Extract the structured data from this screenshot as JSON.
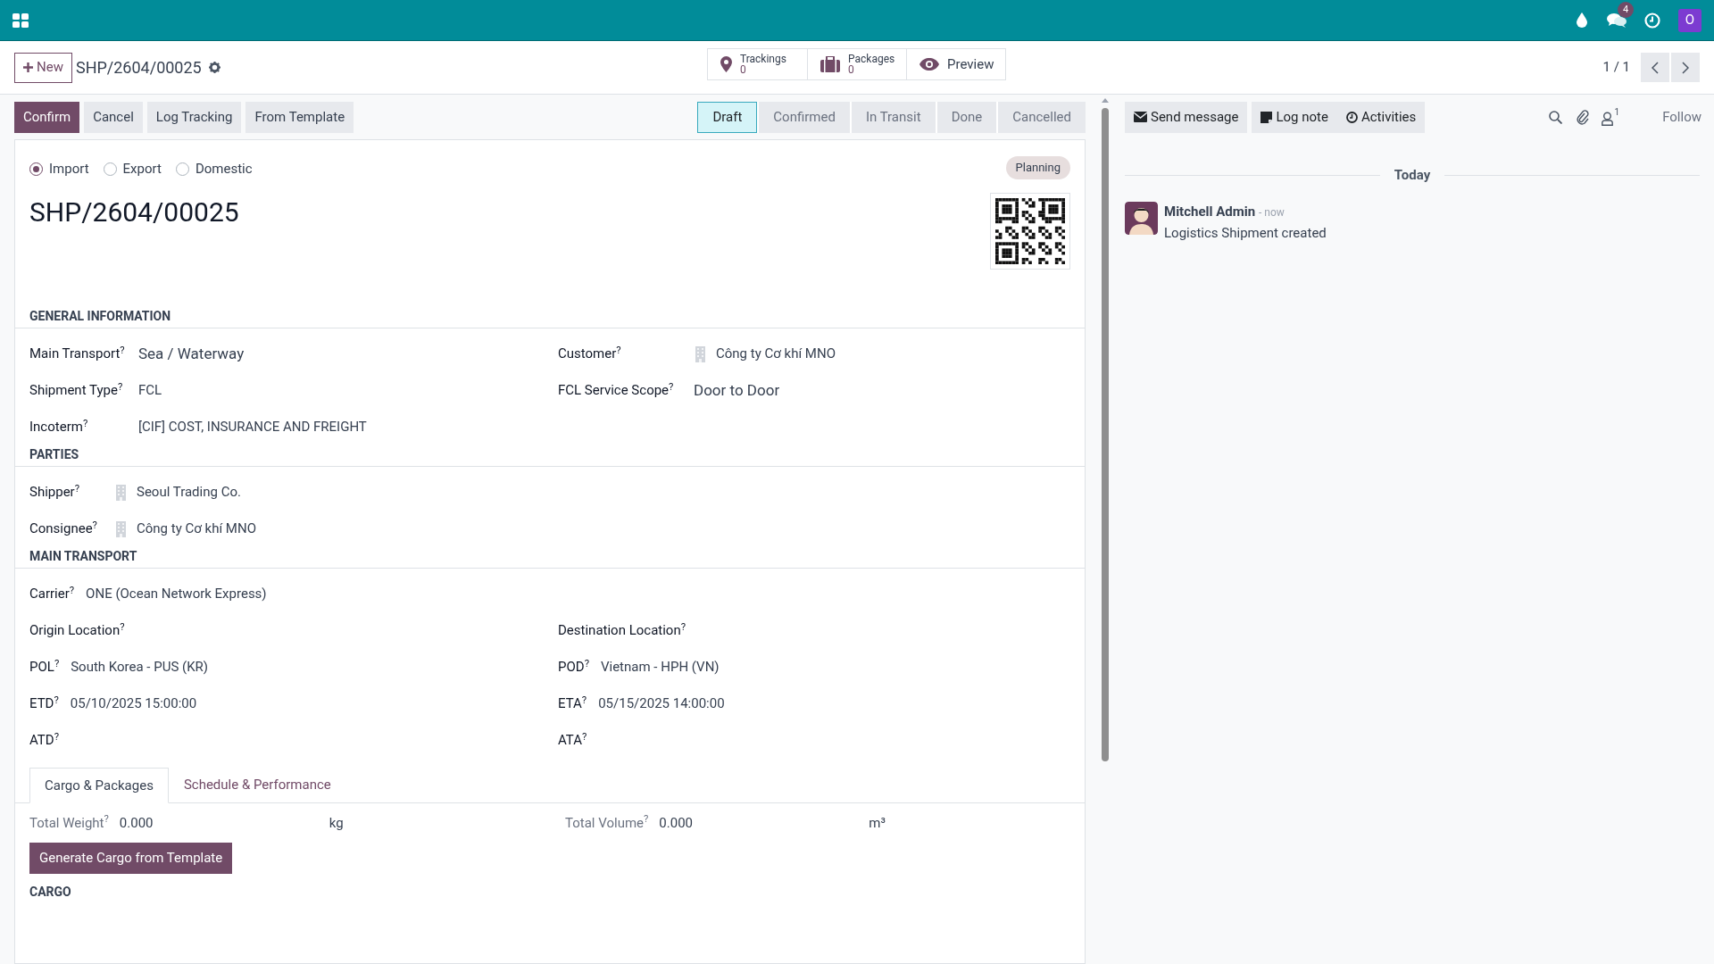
{
  "navbar": {
    "message_count": "4",
    "avatar_letter": "O"
  },
  "control_panel": {
    "new_button": "New",
    "breadcrumb": "SHP/2604/00025",
    "smart_buttons": [
      {
        "kind": "stat",
        "label": "Trackings",
        "value": "0"
      },
      {
        "kind": "stat",
        "label": "Packages",
        "value": "0"
      },
      {
        "kind": "action",
        "label": "Preview"
      }
    ],
    "pager": "1 / 1"
  },
  "action_buttons": [
    {
      "label": "Confirm",
      "kind": "primary"
    },
    {
      "label": "Cancel",
      "kind": "secondary"
    },
    {
      "label": "Log Tracking",
      "kind": "secondary"
    },
    {
      "label": "From Template",
      "kind": "secondary"
    }
  ],
  "status_steps": [
    {
      "label": "Draft",
      "selected": true
    },
    {
      "label": "Confirmed",
      "selected": false
    },
    {
      "label": "In Transit",
      "selected": false
    },
    {
      "label": "Done",
      "selected": false
    },
    {
      "label": "Cancelled",
      "selected": false
    }
  ],
  "form": {
    "direction_options": [
      {
        "label": "Import",
        "selected": true
      },
      {
        "label": "Export",
        "selected": false
      },
      {
        "label": "Domestic",
        "selected": false
      }
    ],
    "tag": "Planning",
    "title": "SHP/2604/00025",
    "sections": [
      {
        "title": "GENERAL INFORMATION",
        "rows": [
          [
            {
              "label": "Main Transport$^{?}$",
              "kind": "selection",
              "value": "Sea / Waterway"
            },
            {
              "label": "Customer$^{?}$",
              "kind": "partner",
              "value": "Công ty Cơ khí MNO"
            }
          ],
          [
            {
              "label": "Shipment Type$^{?}$",
              "kind": "text",
              "value": "FCL"
            },
            {
              "label": "FCL Service Scope$^{?}$",
              "kind": "selection",
              "value": "Door to Door"
            }
          ],
          [
            {
              "label": "Incoterm$^{?}$",
              "kind": "text",
              "value": "[CIF] COST, INSURANCE AND FREIGHT"
            }
          ]
        ]
      },
      {
        "title": "PARTIES",
        "rows": [
          [
            {
              "label": "Shipper$^{?}$",
              "kind": "partner",
              "value": "Seoul Trading Co."
            }
          ],
          [
            {
              "label": "Consignee$^{?}$",
              "kind": "partner",
              "value": "Công ty Cơ khí MNO"
            }
          ]
        ]
      },
      {
        "title": "MAIN TRANSPORT",
        "rows": [
          [
            {
              "label": "Carrier$^{?}$",
              "kind": "text",
              "value": "ONE (Ocean Network Express)"
            }
          ],
          [
            {
              "label": "Origin Location$^{?}$",
              "kind": "empty"
            },
            {
              "label": "Destination Location$^{?}$",
              "kind": "empty"
            }
          ],
          [
            {
              "label": "POL$^{?}$",
              "kind": "text",
              "value": "South Korea - PUS (KR)"
            },
            {
              "label": "POD$^{?}$",
              "kind": "text",
              "value": "Vietnam - HPH (VN)"
            }
          ],
          [
            {
              "label": "ETD$^{?}$",
              "kind": "text",
              "value": "05/10/2025 15:00:00"
            },
            {
              "label": "ETA$^{?}$",
              "kind": "text",
              "value": "05/15/2025 14:00:00"
            }
          ],
          [
            {
              "label": "ATD$^{?}$",
              "kind": "empty"
            },
            {
              "label": "ATA$^{?}$",
              "kind": "empty"
            }
          ]
        ]
      }
    ],
    "tabs": [
      {
        "label": "Cargo & Packages",
        "selected": true
      },
      {
        "label": "Schedule & Performance",
        "selected": false
      }
    ],
    "totals": [
      {
        "label": "Total Weight$^{?}$",
        "value": "0.000",
        "unit": "kg"
      },
      {
        "label": "Total Volume$^{?}$",
        "value": "0.000",
        "unit": "m³"
      }
    ],
    "generate_button": "Generate Cargo from Template",
    "next_section": "CARGO"
  },
  "chatter": {
    "buttons": [
      "Send message",
      "Log note",
      "Activities"
    ],
    "follower_count": "1",
    "follow": "Follow",
    "date_divider": "Today",
    "messages": [
      {
        "author": "Mitchell Admin",
        "time": "- now",
        "body": "Logistics Shipment created"
      }
    ]
  }
}
